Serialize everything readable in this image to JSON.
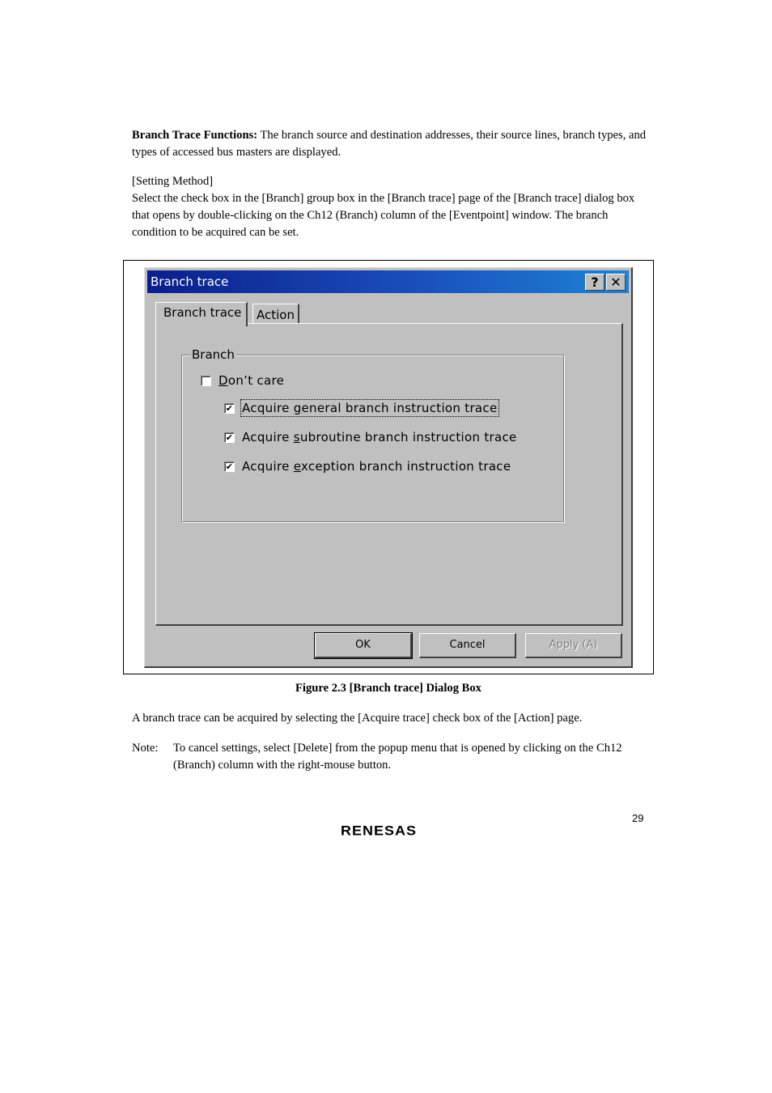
{
  "intro": {
    "heading": "Branch Trace Functions:",
    "text": " The branch source and destination addresses, their source lines, branch types, and types of accessed bus masters are displayed."
  },
  "setting": {
    "heading": "[Setting Method]",
    "text": "Select the check box in the [Branch] group box in the [Branch trace] page of the [Branch trace] dialog box that opens by double-clicking on the Ch12 (Branch) column of the [Eventpoint] window. The branch condition to be acquired can be set."
  },
  "dialog": {
    "title": "Branch trace",
    "help_label": "?",
    "close_label": "✕",
    "tabs": [
      {
        "label": "Branch trace",
        "active": true
      },
      {
        "label": "Action",
        "active": false
      }
    ],
    "group": {
      "label": "Branch",
      "checkboxes": [
        {
          "pre": "",
          "accel": "D",
          "post": "on’t care",
          "checked": false
        },
        {
          "pre": "Acquire ",
          "accel": "g",
          "post": "eneral branch instruction trace",
          "checked": true
        },
        {
          "pre": "Acquire ",
          "accel": "s",
          "post": "ubroutine branch instruction trace",
          "checked": true
        },
        {
          "pre": "Acquire ",
          "accel": "e",
          "post": "xception branch instruction trace",
          "checked": true
        }
      ]
    },
    "buttons": {
      "ok": "OK",
      "cancel": "Cancel",
      "apply": "Apply (A)"
    }
  },
  "caption": "Figure 2.3   [Branch trace] Dialog Box",
  "paragraph": "A branch trace can be acquired by selecting the [Acquire trace] check box of the [Action] page.",
  "note": {
    "label": "Note:",
    "text": "To cancel settings, select [Delete] from the popup menu that is opened by clicking on the Ch12 (Branch) column with the right-mouse button."
  },
  "page_number": "29",
  "logo": "RENESAS",
  "check_glyph": "✔"
}
